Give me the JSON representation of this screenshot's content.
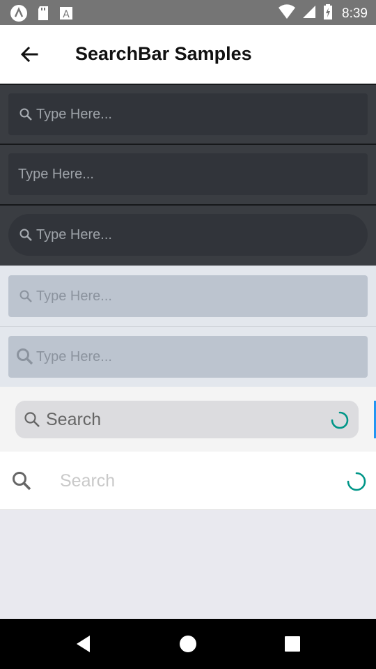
{
  "status_bar": {
    "time": "8:39",
    "left_icons": [
      "app-logo-icon",
      "sd-card-icon",
      "font-a-icon"
    ],
    "right_icons": [
      "wifi-icon",
      "signal-icon",
      "battery-charging-icon"
    ]
  },
  "app_bar": {
    "title": "SearchBar Samples",
    "back_icon": "arrow-left-icon"
  },
  "samples": [
    {
      "style": "dark",
      "placeholder": "Type Here...",
      "icon": "search-icon"
    },
    {
      "style": "dark-no-icon",
      "placeholder": "Type Here..."
    },
    {
      "style": "dark-rounded",
      "placeholder": "Type Here...",
      "icon": "search-icon"
    },
    {
      "style": "light",
      "placeholder": "Type Here...",
      "icon": "search-icon"
    },
    {
      "style": "light-large-icon",
      "placeholder": "Type Here...",
      "icon": "search-icon"
    }
  ],
  "forms_searchbar": {
    "placeholder": "Search",
    "icon": "search-icon",
    "spinner": "loading-spinner"
  },
  "material_searchbar": {
    "placeholder": "Search",
    "icon": "search-icon",
    "spinner": "loading-spinner"
  },
  "nav_bar": {
    "buttons": [
      "back-triangle-icon",
      "home-circle-icon",
      "recents-square-icon"
    ]
  },
  "colors": {
    "accent_teal": "#009688",
    "accent_blue": "#2196f3",
    "dark_bg": "#3a3d42",
    "light_bg": "#e3e7ed"
  }
}
